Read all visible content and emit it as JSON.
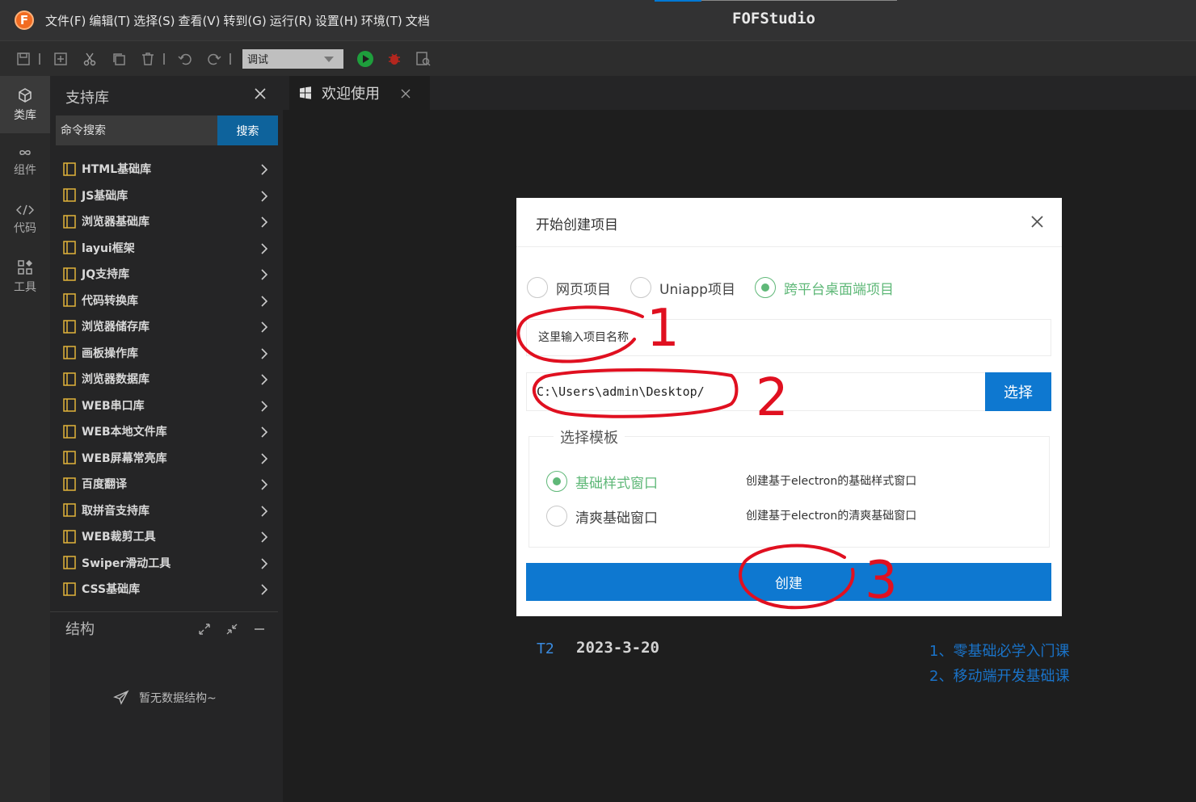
{
  "app": {
    "logo_letter": "F",
    "window_title": "FOFStudio",
    "menu": [
      "文件(F)",
      "编辑(T)",
      "选择(S)",
      "查看(V)",
      "转到(G)",
      "运行(R)",
      "设置(H)",
      "环境(T)",
      "文档"
    ]
  },
  "toolbar": {
    "mode_select_value": "调试"
  },
  "activitybar": {
    "items": [
      {
        "label": "类库",
        "icon": "cube-icon"
      },
      {
        "label": "组件",
        "icon": "infinity-icon"
      },
      {
        "label": "代码",
        "icon": "code-icon"
      },
      {
        "label": "工具",
        "icon": "grid-icon"
      }
    ]
  },
  "sidebar": {
    "title": "支持库",
    "search_placeholder": "命令搜索",
    "search_button": "搜索",
    "libraries": [
      "HTML基础库",
      "JS基础库",
      "浏览器基础库",
      "layui框架",
      "JQ支持库",
      "代码转换库",
      "浏览器储存库",
      "画板操作库",
      "浏览器数据库",
      "WEB串口库",
      "WEB本地文件库",
      "WEB屏幕常亮库",
      "百度翻译",
      "取拼音支持库",
      "WEB裁剪工具",
      "Swiper滑动工具",
      "CSS基础库"
    ],
    "structure_title": "结构",
    "structure_empty": "暂无数据结构~"
  },
  "editor": {
    "tab_label": "欢迎使用",
    "version_tag": "T2",
    "version_date": "2023-3-20",
    "links": [
      "1、零基础必学入门课",
      "2、移动端开发基础课"
    ]
  },
  "modal": {
    "title": "开始创建项目",
    "project_types": [
      "网页项目",
      "Uniapp项目",
      "跨平台桌面端项目"
    ],
    "selected_type": "跨平台桌面端项目",
    "name_placeholder": "这里输入项目名称",
    "path_value": "C:\\Users\\admin\\Desktop/",
    "choose_button": "选择",
    "template_legend": "选择模板",
    "templates": [
      {
        "name": "基础样式窗口",
        "desc": "创建基于electron的基础样式窗口",
        "checked": true
      },
      {
        "name": "清爽基础窗口",
        "desc": "创建基于electron的清爽基础窗口",
        "checked": false
      }
    ],
    "create_button": "创建"
  },
  "annotations": [
    "1",
    "2",
    "3"
  ],
  "colors": {
    "accent": "#0e78d0",
    "success": "#5fb878",
    "annotation": "#e01020"
  }
}
